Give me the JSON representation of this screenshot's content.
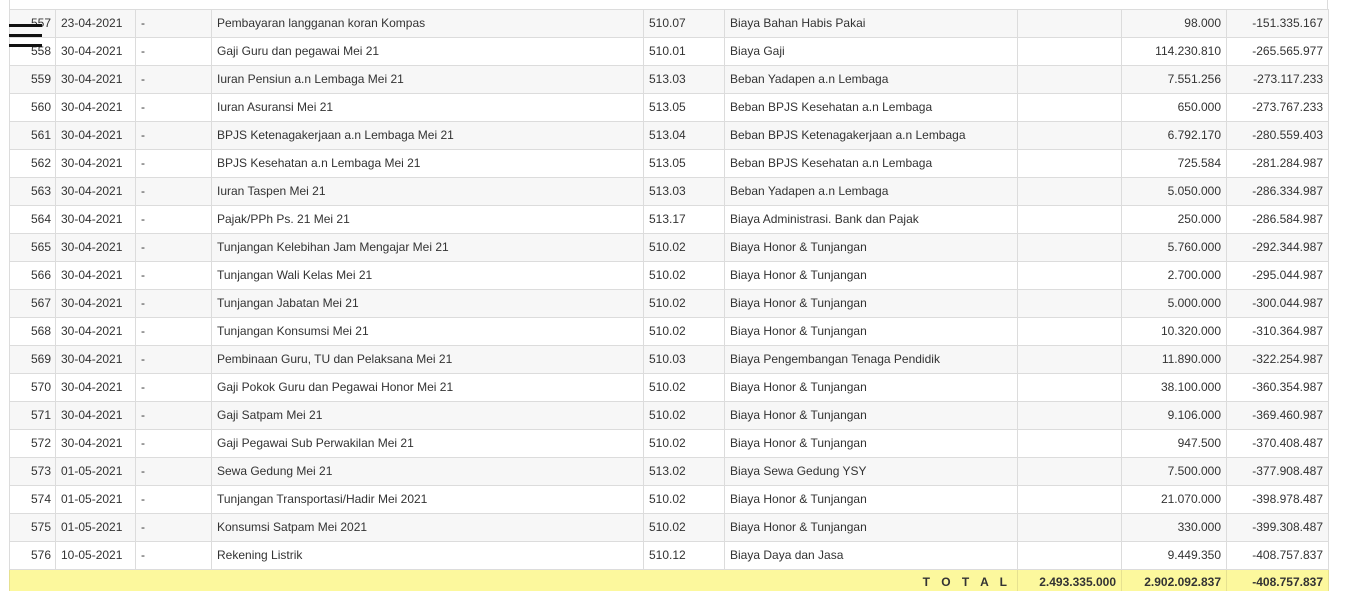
{
  "menu": {
    "icon": "hamburger-menu-icon"
  },
  "rows": [
    {
      "no": "557",
      "date": "23-04-2021",
      "ref": "-",
      "desc": "Pembayaran langganan koran Kompas",
      "code": "510.07",
      "account": "Biaya Bahan Habis Pakai",
      "debit": "",
      "credit": "98.000",
      "balance": "-151.335.167"
    },
    {
      "no": "558",
      "date": "30-04-2021",
      "ref": "-",
      "desc": "Gaji Guru dan pegawai Mei 21",
      "code": "510.01",
      "account": "Biaya Gaji",
      "debit": "",
      "credit": "114.230.810",
      "balance": "-265.565.977"
    },
    {
      "no": "559",
      "date": "30-04-2021",
      "ref": "-",
      "desc": "Iuran Pensiun a.n Lembaga Mei 21",
      "code": "513.03",
      "account": "Beban Yadapen a.n Lembaga",
      "debit": "",
      "credit": "7.551.256",
      "balance": "-273.117.233"
    },
    {
      "no": "560",
      "date": "30-04-2021",
      "ref": "-",
      "desc": "Iuran Asuransi Mei 21",
      "code": "513.05",
      "account": "Beban BPJS Kesehatan a.n Lembaga",
      "debit": "",
      "credit": "650.000",
      "balance": "-273.767.233"
    },
    {
      "no": "561",
      "date": "30-04-2021",
      "ref": "-",
      "desc": "BPJS Ketenagakerjaan a.n Lembaga Mei 21",
      "code": "513.04",
      "account": "Beban BPJS Ketenagakerjaan a.n Lembaga",
      "debit": "",
      "credit": "6.792.170",
      "balance": "-280.559.403"
    },
    {
      "no": "562",
      "date": "30-04-2021",
      "ref": "-",
      "desc": "BPJS Kesehatan a.n Lembaga Mei 21",
      "code": "513.05",
      "account": "Beban BPJS Kesehatan a.n Lembaga",
      "debit": "",
      "credit": "725.584",
      "balance": "-281.284.987"
    },
    {
      "no": "563",
      "date": "30-04-2021",
      "ref": "-",
      "desc": "Iuran Taspen Mei 21",
      "code": "513.03",
      "account": "Beban Yadapen a.n Lembaga",
      "debit": "",
      "credit": "5.050.000",
      "balance": "-286.334.987"
    },
    {
      "no": "564",
      "date": "30-04-2021",
      "ref": "-",
      "desc": "Pajak/PPh Ps. 21 Mei 21",
      "code": "513.17",
      "account": "Biaya Administrasi. Bank dan Pajak",
      "debit": "",
      "credit": "250.000",
      "balance": "-286.584.987"
    },
    {
      "no": "565",
      "date": "30-04-2021",
      "ref": "-",
      "desc": "Tunjangan Kelebihan Jam Mengajar Mei 21",
      "code": "510.02",
      "account": "Biaya Honor & Tunjangan",
      "debit": "",
      "credit": "5.760.000",
      "balance": "-292.344.987"
    },
    {
      "no": "566",
      "date": "30-04-2021",
      "ref": "-",
      "desc": "Tunjangan Wali Kelas Mei 21",
      "code": "510.02",
      "account": "Biaya Honor & Tunjangan",
      "debit": "",
      "credit": "2.700.000",
      "balance": "-295.044.987"
    },
    {
      "no": "567",
      "date": "30-04-2021",
      "ref": "-",
      "desc": "Tunjangan Jabatan Mei 21",
      "code": "510.02",
      "account": "Biaya Honor & Tunjangan",
      "debit": "",
      "credit": "5.000.000",
      "balance": "-300.044.987"
    },
    {
      "no": "568",
      "date": "30-04-2021",
      "ref": "-",
      "desc": "Tunjangan Konsumsi Mei 21",
      "code": "510.02",
      "account": "Biaya Honor & Tunjangan",
      "debit": "",
      "credit": "10.320.000",
      "balance": "-310.364.987"
    },
    {
      "no": "569",
      "date": "30-04-2021",
      "ref": "-",
      "desc": "Pembinaan Guru, TU dan Pelaksana Mei 21",
      "code": "510.03",
      "account": "Biaya Pengembangan Tenaga Pendidik",
      "debit": "",
      "credit": "11.890.000",
      "balance": "-322.254.987"
    },
    {
      "no": "570",
      "date": "30-04-2021",
      "ref": "-",
      "desc": "Gaji Pokok Guru dan Pegawai Honor Mei 21",
      "code": "510.02",
      "account": "Biaya Honor & Tunjangan",
      "debit": "",
      "credit": "38.100.000",
      "balance": "-360.354.987"
    },
    {
      "no": "571",
      "date": "30-04-2021",
      "ref": "-",
      "desc": "Gaji Satpam Mei 21",
      "code": "510.02",
      "account": "Biaya Honor & Tunjangan",
      "debit": "",
      "credit": "9.106.000",
      "balance": "-369.460.987"
    },
    {
      "no": "572",
      "date": "30-04-2021",
      "ref": "-",
      "desc": "Gaji Pegawai Sub Perwakilan Mei 21",
      "code": "510.02",
      "account": "Biaya Honor & Tunjangan",
      "debit": "",
      "credit": "947.500",
      "balance": "-370.408.487"
    },
    {
      "no": "573",
      "date": "01-05-2021",
      "ref": "-",
      "desc": "Sewa Gedung Mei 21",
      "code": "513.02",
      "account": "Biaya Sewa Gedung YSY",
      "debit": "",
      "credit": "7.500.000",
      "balance": "-377.908.487"
    },
    {
      "no": "574",
      "date": "01-05-2021",
      "ref": "-",
      "desc": "Tunjangan Transportasi/Hadir Mei 2021",
      "code": "510.02",
      "account": "Biaya Honor & Tunjangan",
      "debit": "",
      "credit": "21.070.000",
      "balance": "-398.978.487"
    },
    {
      "no": "575",
      "date": "01-05-2021",
      "ref": "-",
      "desc": "Konsumsi Satpam Mei 2021",
      "code": "510.02",
      "account": "Biaya Honor & Tunjangan",
      "debit": "",
      "credit": "330.000",
      "balance": "-399.308.487"
    },
    {
      "no": "576",
      "date": "10-05-2021",
      "ref": "-",
      "desc": "Rekening Listrik",
      "code": "510.12",
      "account": "Biaya Daya dan Jasa",
      "debit": "",
      "credit": "9.449.350",
      "balance": "-408.757.837"
    }
  ],
  "totals": {
    "label": "T O T A L",
    "debit": "2.493.335.000",
    "credit": "2.902.092.837",
    "balance": "-408.757.837"
  },
  "colors": {
    "total_row_bg": "#fcf89d",
    "stripe_bg": "#f7f7f7",
    "border": "#dcdcdc"
  }
}
